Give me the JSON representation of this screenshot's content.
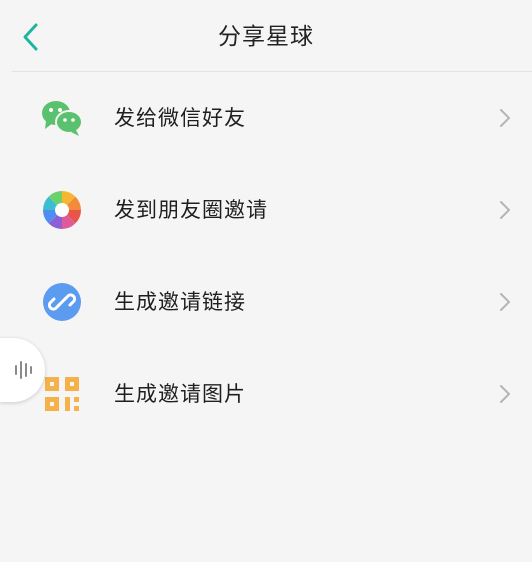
{
  "header": {
    "title": "分享星球",
    "back_icon": "chevron-left-icon",
    "accent_color": "#1fb59f"
  },
  "menu": {
    "items": [
      {
        "label": "发给微信好友",
        "icon": "wechat-icon"
      },
      {
        "label": "发到朋友圈邀请",
        "icon": "moments-icon"
      },
      {
        "label": "生成邀请链接",
        "icon": "link-icon"
      },
      {
        "label": "生成邀请图片",
        "icon": "qrcode-icon"
      }
    ]
  },
  "colors": {
    "background": "#f5f5f5",
    "wechat_green": "#5ac16f",
    "link_blue": "#5b9cf0",
    "qr_orange": "#f5b24a"
  },
  "side_handle": {
    "icon": "audio-bars-icon"
  }
}
